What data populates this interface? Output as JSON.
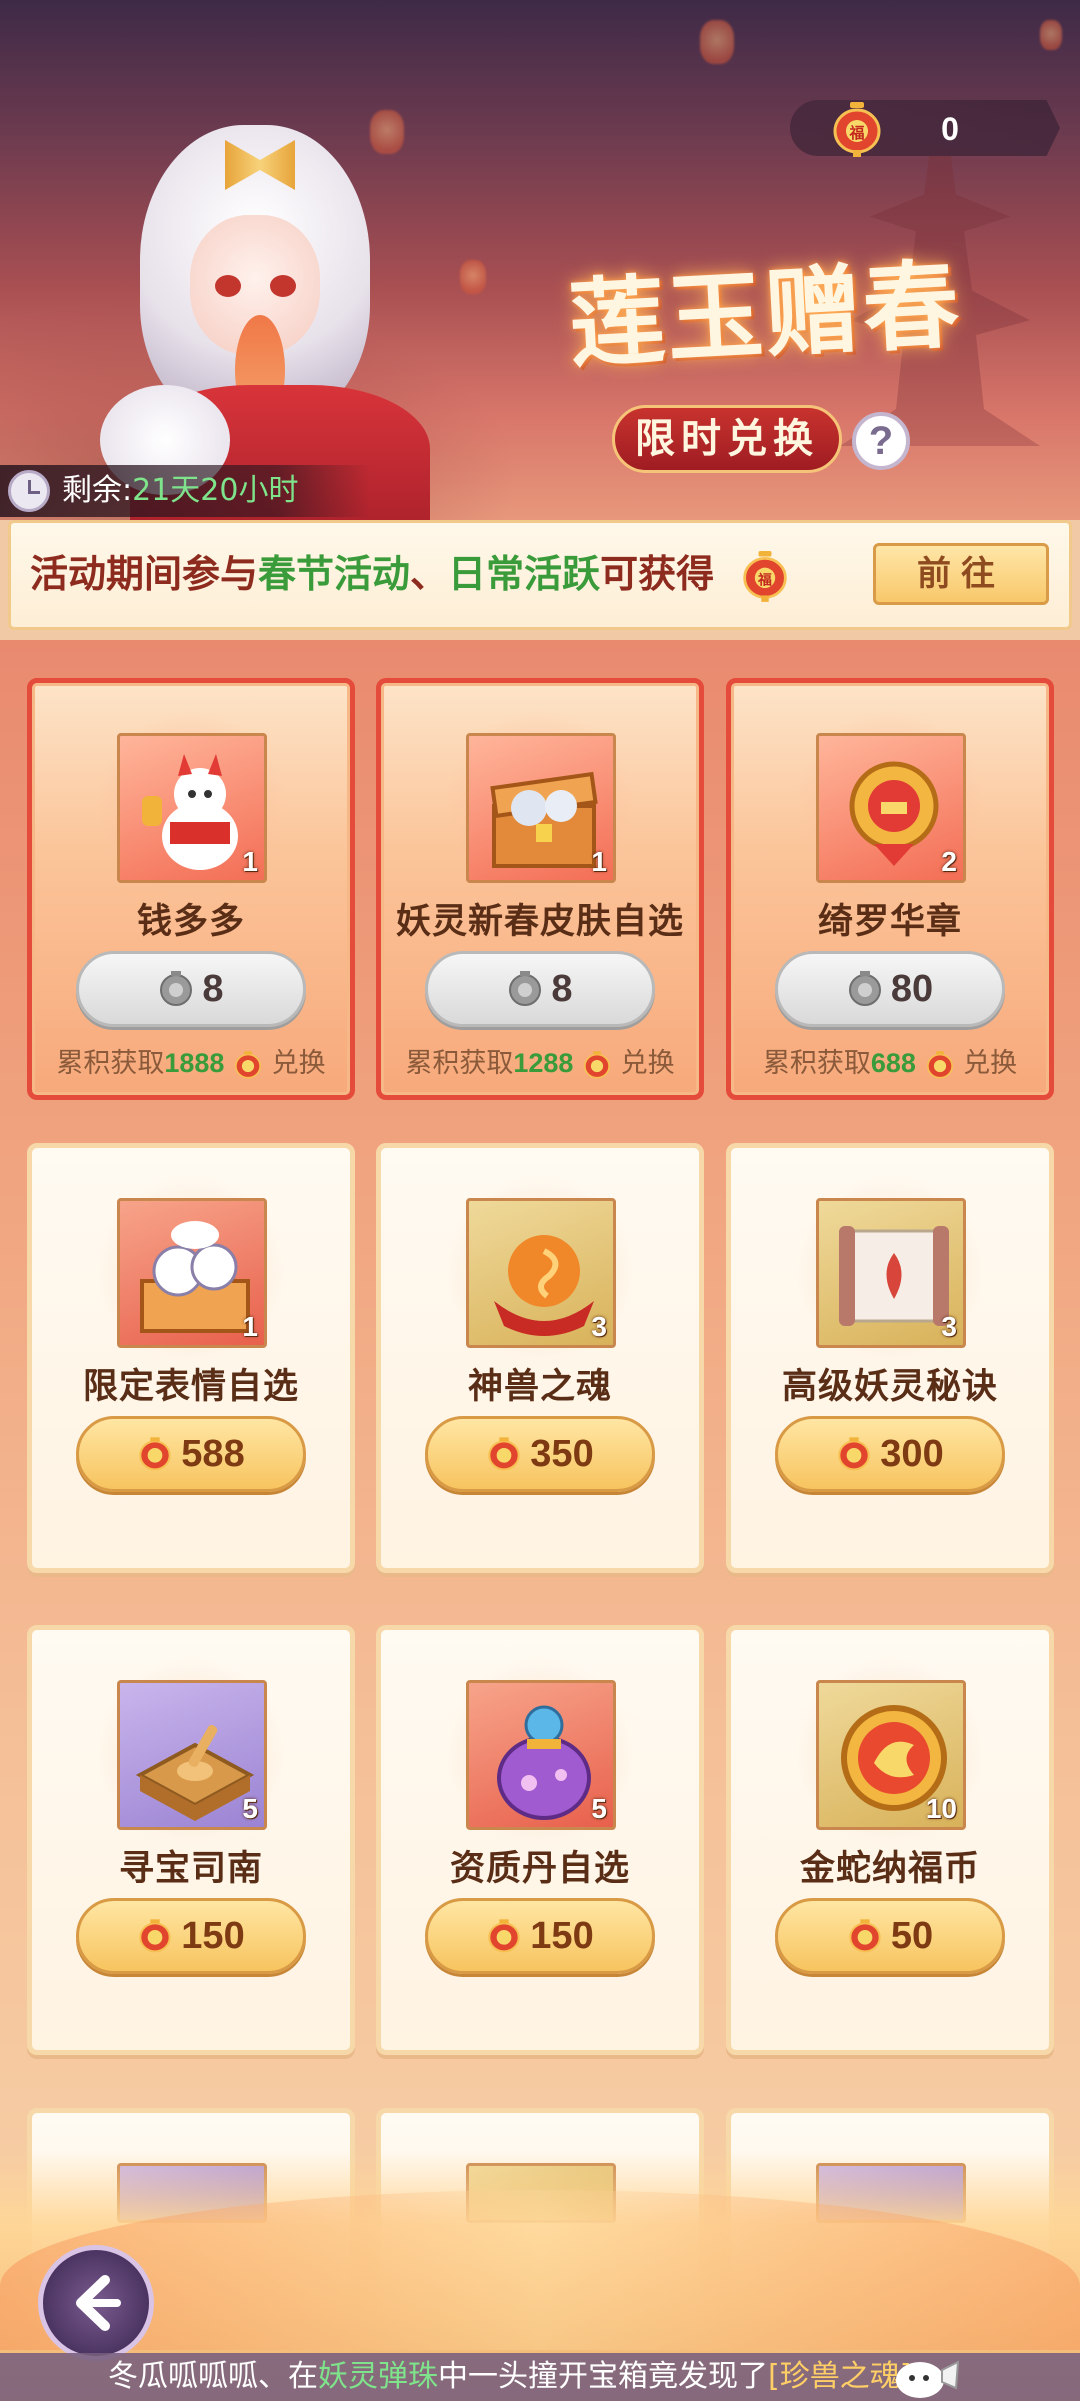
{
  "header": {
    "currency_value": "0",
    "title": "莲玉赠春",
    "subtitle": "限时兑换",
    "help": "?",
    "timer_prefix": "剩余:",
    "timer_value": "21天20小时"
  },
  "info": {
    "text_a": "活动期间参与",
    "text_b": "春节活动",
    "text_c": "、",
    "text_d": "日常活跃",
    "text_e": "可获得",
    "go_label": "前往"
  },
  "colors": {
    "accent_red": "#e54b3a",
    "gold": "#f7c45f",
    "highlight_green": "#3a9b3a"
  },
  "items": [
    {
      "name": "钱多多",
      "count": "1",
      "price": "8",
      "currency": "silver-lantern-icon",
      "footer_prefix": "累积获取",
      "footer_num": "1888",
      "footer_suffix": "兑换",
      "style": "red"
    },
    {
      "name": "妖灵新春皮肤自选",
      "count": "1",
      "price": "8",
      "currency": "silver-lantern-icon",
      "footer_prefix": "累积获取",
      "footer_num": "1288",
      "footer_suffix": "兑换",
      "style": "red"
    },
    {
      "name": "绮罗华章",
      "count": "2",
      "price": "80",
      "currency": "silver-lantern-icon",
      "footer_prefix": "累积获取",
      "footer_num": "688",
      "footer_suffix": "兑换",
      "style": "red"
    },
    {
      "name": "限定表情自选",
      "count": "1",
      "price": "588",
      "currency": "lantern-icon",
      "style": "white"
    },
    {
      "name": "神兽之魂",
      "count": "3",
      "price": "350",
      "currency": "lantern-icon",
      "style": "white"
    },
    {
      "name": "高级妖灵秘诀",
      "count": "3",
      "price": "300",
      "currency": "lantern-icon",
      "style": "white"
    },
    {
      "name": "寻宝司南",
      "count": "5",
      "price": "150",
      "currency": "lantern-icon",
      "style": "white"
    },
    {
      "name": "资质丹自选",
      "count": "5",
      "price": "150",
      "currency": "lantern-icon",
      "style": "white"
    },
    {
      "name": "金蛇纳福币",
      "count": "10",
      "price": "50",
      "currency": "lantern-icon",
      "style": "white"
    }
  ],
  "ticker": {
    "a": "冬瓜呱呱呱、在",
    "b": "妖灵弹珠",
    "c": "中一头撞开宝箱竟发现了",
    "d": "[珍兽之魂]"
  }
}
